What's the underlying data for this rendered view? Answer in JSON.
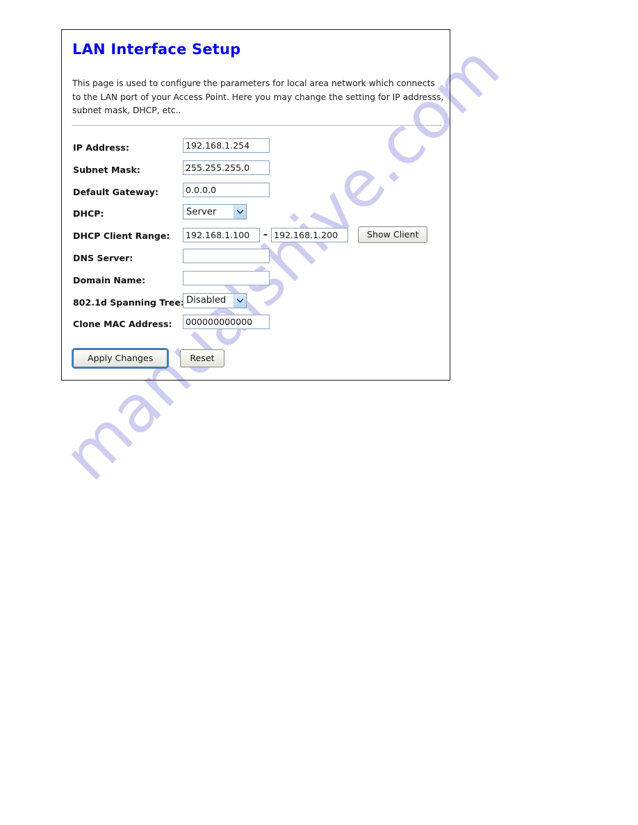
{
  "page": {
    "title": "LAN Interface Setup",
    "description": "This page is used to configure the parameters for local area network which connects to the LAN port of your Access Point. Here you may change the setting for IP addresss, subnet mask, DHCP, etc..",
    "title_color": "#0707e8"
  },
  "watermark": {
    "text": "manualshive.com",
    "color": "#c9c9ef"
  },
  "form": {
    "ip_address": {
      "label": "IP Address:",
      "value": "192.168.1.254"
    },
    "subnet_mask": {
      "label": "Subnet Mask:",
      "value": "255.255.255.0"
    },
    "default_gateway": {
      "label": "Default Gateway:",
      "value": "0.0.0.0"
    },
    "dhcp": {
      "label": "DHCP:",
      "value": "Server"
    },
    "dhcp_client_range": {
      "label": "DHCP Client Range:",
      "start": "192.168.1.100",
      "separator": "–",
      "end": "192.168.1.200",
      "button": "Show Client"
    },
    "dns_server": {
      "label": "DNS Server:",
      "value": ""
    },
    "domain_name": {
      "label": "Domain Name:",
      "value": ""
    },
    "spanning_tree": {
      "label": "802.1d Spanning Tree:",
      "value": "Disabled"
    },
    "clone_mac_address": {
      "label": "Clone MAC Address:",
      "value": "000000000000"
    }
  },
  "actions": {
    "apply": "Apply Changes",
    "reset": "Reset"
  }
}
